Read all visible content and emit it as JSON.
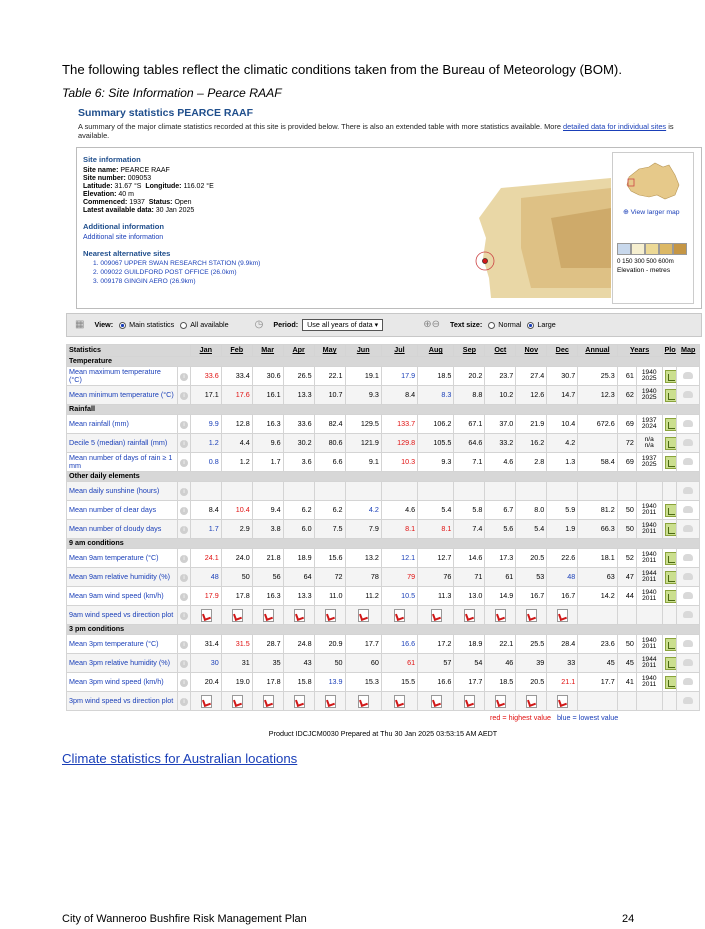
{
  "intro": "The following tables reflect the climatic conditions taken from the Bureau of Meteorology (BOM).",
  "caption": "Table 6: Site Information – Pearce RAAF",
  "summary": {
    "title": "Summary statistics PEARCE RAAF",
    "desc": "A summary of the major climate statistics recorded at this site is provided below. There is also an extended table with more statistics available. More",
    "desc_link": "detailed data for individual sites",
    "desc_end": "is available."
  },
  "site": {
    "heading": "Site information",
    "name_label": "Site name:",
    "name": "PEARCE RAAF",
    "number_label": "Site number:",
    "number": "009053",
    "lat_label": "Latitude:",
    "lat": "31.67 °S",
    "lon_label": "Longitude:",
    "lon": "116.02 °E",
    "elev_label": "Elevation:",
    "elev": "40 m",
    "commenced_label": "Commenced:",
    "commenced": "1937",
    "status_label": "Status:",
    "status": "Open",
    "latest_label": "Latest available data:",
    "latest": "30 Jan 2025",
    "additional_heading": "Additional information",
    "additional_link": "Additional site information",
    "nearest_heading": "Nearest alternative sites",
    "alternatives": [
      "1. 009067   UPPER SWAN RESEARCH STATION (9.9km)",
      "2. 009022   GUILDFORD POST OFFICE (26.0km)",
      "3. 009178   GINGIN AERO (26.9km)"
    ],
    "view_larger": "View larger map",
    "elev_ticks": "0  150 300 500 600m",
    "elev_legend": "Elevation - metres"
  },
  "controls": {
    "view_label": "View:",
    "main_stats": "Main statistics",
    "all_available": "All available",
    "period_label": "Period:",
    "period_value": "Use all years of data",
    "text_size_label": "Text size:",
    "normal": "Normal",
    "large": "Large"
  },
  "table": {
    "headers": [
      "Statistics",
      "Jan",
      "Feb",
      "Mar",
      "Apr",
      "May",
      "Jun",
      "Jul",
      "Aug",
      "Sep",
      "Oct",
      "Nov",
      "Dec",
      "Annual",
      "Years",
      "Plot",
      "Map"
    ],
    "sections": [
      {
        "title": "Temperature",
        "rows": [
          {
            "label": "Mean maximum temperature (°C)",
            "vals": [
              "33.6",
              "33.4",
              "30.6",
              "26.5",
              "22.1",
              "19.1",
              "17.9",
              "18.5",
              "20.2",
              "23.7",
              "27.4",
              "30.7"
            ],
            "hi": 0,
            "lo": 6,
            "annual": "25.3",
            "years": "61",
            "range": [
              "1940",
              "2025"
            ]
          },
          {
            "label": "Mean minimum temperature (°C)",
            "vals": [
              "17.1",
              "17.6",
              "16.1",
              "13.3",
              "10.7",
              "9.3",
              "8.4",
              "8.3",
              "8.8",
              "10.2",
              "12.6",
              "14.7"
            ],
            "hi": 1,
            "lo": 7,
            "annual": "12.3",
            "years": "62",
            "range": [
              "1940",
              "2025"
            ]
          }
        ]
      },
      {
        "title": "Rainfall",
        "rows": [
          {
            "label": "Mean rainfall (mm)",
            "vals": [
              "9.9",
              "12.8",
              "16.3",
              "33.6",
              "82.4",
              "129.5",
              "133.7",
              "106.2",
              "67.1",
              "37.0",
              "21.9",
              "10.4"
            ],
            "hi": 6,
            "lo": 0,
            "annual": "672.6",
            "years": "69",
            "range": [
              "1937",
              "2024"
            ]
          },
          {
            "label": "Decile 5 (median) rainfall (mm)",
            "vals": [
              "1.2",
              "4.4",
              "9.6",
              "30.2",
              "80.6",
              "121.9",
              "129.8",
              "105.5",
              "64.6",
              "33.2",
              "16.2",
              "4.2"
            ],
            "hi": 6,
            "lo": 0,
            "annual": "",
            "years": "72",
            "range": [
              "n/a",
              "n/a"
            ]
          },
          {
            "label": "Mean number of days of rain ≥ 1 mm",
            "vals": [
              "0.8",
              "1.2",
              "1.7",
              "3.6",
              "6.6",
              "9.1",
              "10.3",
              "9.3",
              "7.1",
              "4.6",
              "2.8",
              "1.3"
            ],
            "hi": 6,
            "lo": 0,
            "annual": "58.4",
            "years": "69",
            "range": [
              "1937",
              "2025"
            ]
          }
        ]
      },
      {
        "title": "Other daily elements",
        "rows": [
          {
            "label": "Mean daily sunshine (hours)",
            "vals": [
              "",
              "",
              "",
              "",
              "",
              "",
              "",
              "",
              "",
              "",
              "",
              ""
            ],
            "hi": -1,
            "lo": -1,
            "annual": "",
            "years": "",
            "range": [
              "",
              ""
            ],
            "noplot": true
          },
          {
            "label": "Mean number of clear days",
            "vals": [
              "8.4",
              "10.4",
              "9.4",
              "6.2",
              "6.2",
              "4.2",
              "4.6",
              "5.4",
              "5.8",
              "6.7",
              "8.0",
              "5.9"
            ],
            "hi": 1,
            "lo": 5,
            "annual": "81.2",
            "years": "50",
            "range": [
              "1940",
              "2011"
            ]
          },
          {
            "label": "Mean number of cloudy days",
            "vals": [
              "1.7",
              "2.9",
              "3.8",
              "6.0",
              "7.5",
              "7.9",
              "8.1",
              "8.1",
              "7.4",
              "5.6",
              "5.4",
              "1.9"
            ],
            "hi": 6,
            "lo": 0,
            "hi2": 7,
            "annual": "66.3",
            "years": "50",
            "range": [
              "1940",
              "2011"
            ]
          }
        ]
      },
      {
        "title": "9 am conditions",
        "rows": [
          {
            "label": "Mean 9am temperature (°C)",
            "vals": [
              "24.1",
              "24.0",
              "21.8",
              "18.9",
              "15.6",
              "13.2",
              "12.1",
              "12.7",
              "14.6",
              "17.3",
              "20.5",
              "22.6"
            ],
            "hi": 0,
            "lo": 6,
            "annual": "18.1",
            "years": "52",
            "range": [
              "1940",
              "2011"
            ]
          },
          {
            "label": "Mean 9am relative humidity (%)",
            "vals": [
              "48",
              "50",
              "56",
              "64",
              "72",
              "78",
              "79",
              "76",
              "71",
              "61",
              "53",
              "48"
            ],
            "hi": 6,
            "lo": 0,
            "lo2": 11,
            "annual": "63",
            "years": "47",
            "range": [
              "1944",
              "2011"
            ]
          },
          {
            "label": "Mean 9am wind speed (km/h)",
            "vals": [
              "17.9",
              "17.8",
              "16.3",
              "13.3",
              "11.0",
              "11.2",
              "10.5",
              "11.3",
              "13.0",
              "14.9",
              "16.7",
              "16.7"
            ],
            "hi": 0,
            "lo": 6,
            "annual": "14.2",
            "years": "44",
            "range": [
              "1940",
              "2011"
            ]
          },
          {
            "label": "9am wind speed vs direction plot",
            "pdf": true
          }
        ]
      },
      {
        "title": "3 pm conditions",
        "rows": [
          {
            "label": "Mean 3pm temperature (°C)",
            "vals": [
              "31.4",
              "31.5",
              "28.7",
              "24.8",
              "20.9",
              "17.7",
              "16.6",
              "17.2",
              "18.9",
              "22.1",
              "25.5",
              "28.4"
            ],
            "hi": 1,
            "lo": 6,
            "annual": "23.6",
            "years": "50",
            "range": [
              "1940",
              "2011"
            ]
          },
          {
            "label": "Mean 3pm relative humidity (%)",
            "vals": [
              "30",
              "31",
              "35",
              "43",
              "50",
              "60",
              "61",
              "57",
              "54",
              "46",
              "39",
              "33"
            ],
            "hi": 6,
            "lo": 0,
            "annual": "45",
            "years": "45",
            "range": [
              "1944",
              "2011"
            ]
          },
          {
            "label": "Mean 3pm wind speed (km/h)",
            "vals": [
              "20.4",
              "19.0",
              "17.8",
              "15.8",
              "13.9",
              "15.3",
              "15.5",
              "16.6",
              "17.7",
              "18.5",
              "20.5",
              "21.1"
            ],
            "hi": 11,
            "lo": 4,
            "annual": "17.7",
            "years": "41",
            "range": [
              "1940",
              "2011"
            ]
          },
          {
            "label": "3pm wind speed vs direction plot",
            "pdf": true
          }
        ]
      }
    ]
  },
  "key_high": "red = highest value",
  "key_low": "blue = lowest value",
  "product": "Product IDCJCM0030 Prepared at Thu 30 Jan 2025 03:53:15 AM AEDT",
  "link": "Climate statistics for Australian locations",
  "footer": {
    "left": "City of Wanneroo Bushfire Risk Management Plan",
    "right": "24"
  },
  "colors": {
    "high": "#e01010",
    "low": "#1a3fb8",
    "header": "#1f4e8c"
  }
}
